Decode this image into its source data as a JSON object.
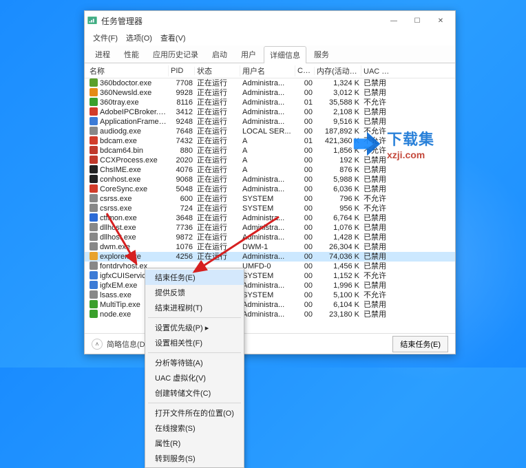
{
  "window": {
    "title": "任务管理器",
    "controls": {
      "min": "—",
      "max": "☐",
      "close": "✕"
    }
  },
  "menubar": {
    "file": "文件(F)",
    "options": "选项(O)",
    "view": "查看(V)"
  },
  "tabs": {
    "items": [
      {
        "label": "进程"
      },
      {
        "label": "性能"
      },
      {
        "label": "应用历史记录"
      },
      {
        "label": "启动"
      },
      {
        "label": "用户"
      },
      {
        "label": "详细信息"
      },
      {
        "label": "服务"
      }
    ],
    "active_index": 5
  },
  "columns": {
    "name": "名称",
    "pid": "PID",
    "status": "状态",
    "user": "用户名",
    "cpu": "CPU",
    "memory": "内存(活动的...",
    "uac": "UAC 虚拟化"
  },
  "processes": [
    {
      "icon": "#5aa02c",
      "name": "360bdoctor.exe",
      "pid": "7708",
      "status": "正在运行",
      "user": "Administra...",
      "cpu": "00",
      "mem": "1,324 K",
      "uac": "已禁用"
    },
    {
      "icon": "#e58b17",
      "name": "360Newsld.exe",
      "pid": "9928",
      "status": "正在运行",
      "user": "Administra...",
      "cpu": "00",
      "mem": "3,012 K",
      "uac": "已禁用"
    },
    {
      "icon": "#3aa02c",
      "name": "360tray.exe",
      "pid": "8116",
      "status": "正在运行",
      "user": "Administra...",
      "cpu": "01",
      "mem": "35,588 K",
      "uac": "不允许"
    },
    {
      "icon": "#d23c2a",
      "name": "AdobeIPCBroker.exe",
      "pid": "3412",
      "status": "正在运行",
      "user": "Administra...",
      "cpu": "00",
      "mem": "2,108 K",
      "uac": "已禁用"
    },
    {
      "icon": "#3c7bd6",
      "name": "ApplicationFrameH...",
      "pid": "9248",
      "status": "正在运行",
      "user": "Administra...",
      "cpu": "00",
      "mem": "9,516 K",
      "uac": "已禁用"
    },
    {
      "icon": "#888",
      "name": "audiodg.exe",
      "pid": "7648",
      "status": "正在运行",
      "user": "LOCAL SER...",
      "cpu": "00",
      "mem": "187,892 K",
      "uac": "不允许"
    },
    {
      "icon": "#d23c2a",
      "name": "bdcam.exe",
      "pid": "7432",
      "status": "正在运行",
      "user": "A",
      "cpu": "01",
      "mem": "421,360 K",
      "uac": "不允许"
    },
    {
      "icon": "#c0392b",
      "name": "bdcam64.bin",
      "pid": "880",
      "status": "正在运行",
      "user": "A",
      "cpu": "00",
      "mem": "1,856 K",
      "uac": "不允许"
    },
    {
      "icon": "#c0392b",
      "name": "CCXProcess.exe",
      "pid": "2020",
      "status": "正在运行",
      "user": "A",
      "cpu": "00",
      "mem": "192 K",
      "uac": "已禁用"
    },
    {
      "icon": "#222",
      "name": "ChsIME.exe",
      "pid": "4076",
      "status": "正在运行",
      "user": "A",
      "cpu": "00",
      "mem": "876 K",
      "uac": "已禁用"
    },
    {
      "icon": "#222",
      "name": "conhost.exe",
      "pid": "9068",
      "status": "正在运行",
      "user": "Administra...",
      "cpu": "00",
      "mem": "5,988 K",
      "uac": "已禁用"
    },
    {
      "icon": "#d23c2a",
      "name": "CoreSync.exe",
      "pid": "5048",
      "status": "正在运行",
      "user": "Administra...",
      "cpu": "00",
      "mem": "6,036 K",
      "uac": "已禁用"
    },
    {
      "icon": "#888",
      "name": "csrss.exe",
      "pid": "600",
      "status": "正在运行",
      "user": "SYSTEM",
      "cpu": "00",
      "mem": "796 K",
      "uac": "不允许"
    },
    {
      "icon": "#888",
      "name": "csrss.exe",
      "pid": "724",
      "status": "正在运行",
      "user": "SYSTEM",
      "cpu": "00",
      "mem": "956 K",
      "uac": "不允许"
    },
    {
      "icon": "#2c6bd6",
      "name": "ctfmon.exe",
      "pid": "3648",
      "status": "正在运行",
      "user": "Administra...",
      "cpu": "00",
      "mem": "6,764 K",
      "uac": "已禁用"
    },
    {
      "icon": "#888",
      "name": "dllhost.exe",
      "pid": "7736",
      "status": "正在运行",
      "user": "Administra...",
      "cpu": "00",
      "mem": "1,076 K",
      "uac": "已禁用"
    },
    {
      "icon": "#888",
      "name": "dllhost.exe",
      "pid": "9872",
      "status": "正在运行",
      "user": "Administra...",
      "cpu": "00",
      "mem": "1,428 K",
      "uac": "已禁用"
    },
    {
      "icon": "#888",
      "name": "dwm.exe",
      "pid": "1076",
      "status": "正在运行",
      "user": "DWM-1",
      "cpu": "00",
      "mem": "26,304 K",
      "uac": "已禁用"
    },
    {
      "icon": "#e8a22b",
      "name": "explorer.exe",
      "pid": "4256",
      "status": "正在运行",
      "user": "Administra...",
      "cpu": "00",
      "mem": "74,036 K",
      "uac": "已禁用",
      "selected": true
    },
    {
      "icon": "#888",
      "name": "fontdrvhost.ex",
      "pid": "",
      "status": "",
      "user": "UMFD-0",
      "cpu": "00",
      "mem": "1,456 K",
      "uac": "已禁用"
    },
    {
      "icon": "#3c7bd6",
      "name": "igfxCUIService",
      "pid": "",
      "status": "",
      "user": "SYSTEM",
      "cpu": "00",
      "mem": "1,152 K",
      "uac": "不允许"
    },
    {
      "icon": "#3c7bd6",
      "name": "igfxEM.exe",
      "pid": "",
      "status": "",
      "user": "Administra...",
      "cpu": "00",
      "mem": "1,996 K",
      "uac": "已禁用"
    },
    {
      "icon": "#888",
      "name": "lsass.exe",
      "pid": "",
      "status": "",
      "user": "SYSTEM",
      "cpu": "00",
      "mem": "5,100 K",
      "uac": "不允许"
    },
    {
      "icon": "#3aa02c",
      "name": "MultiTip.exe",
      "pid": "",
      "status": "",
      "user": "Administra...",
      "cpu": "00",
      "mem": "6,104 K",
      "uac": "已禁用"
    },
    {
      "icon": "#3aa02c",
      "name": "node.exe",
      "pid": "",
      "status": "",
      "user": "Administra...",
      "cpu": "00",
      "mem": "23,180 K",
      "uac": "已禁用"
    }
  ],
  "contextmenu": {
    "items": [
      {
        "label": "结束任务(E)",
        "hl": true
      },
      {
        "label": "提供反馈"
      },
      {
        "label": "结束进程树(T)"
      },
      {
        "sep": true
      },
      {
        "label": "设置优先级(P)",
        "sub": true
      },
      {
        "label": "设置相关性(F)"
      },
      {
        "sep": true
      },
      {
        "label": "分析等待链(A)"
      },
      {
        "label": "UAC 虚拟化(V)"
      },
      {
        "label": "创建转储文件(C)"
      },
      {
        "sep": true
      },
      {
        "label": "打开文件所在的位置(O)"
      },
      {
        "label": "在线搜索(S)"
      },
      {
        "label": "属性(R)"
      },
      {
        "label": "转到服务(S)"
      }
    ]
  },
  "footer": {
    "less": "简略信息(D)",
    "end_task": "结束任务(E)"
  },
  "watermark": {
    "line1": "下载集",
    "line2": "xzji.com"
  }
}
